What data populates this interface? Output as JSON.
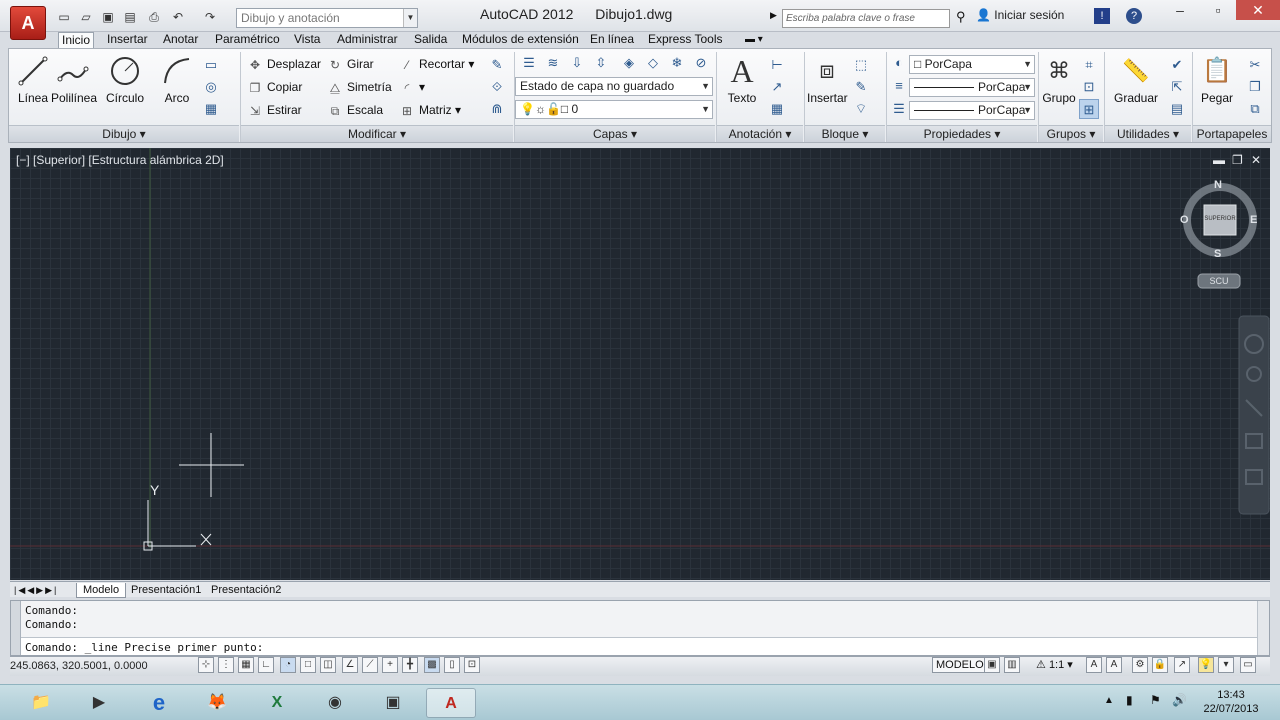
{
  "titlebar": {
    "app_button": "A",
    "workspace": "Dibujo y anotación",
    "app_name": "AutoCAD 2012",
    "doc_name": "Dibujo1.dwg",
    "search_placeholder": "Escriba palabra clave o frase",
    "signin": "Iniciar sesión"
  },
  "tabs": [
    "Inicio",
    "Insertar",
    "Anotar",
    "Paramétrico",
    "Vista",
    "Administrar",
    "Salida",
    "Módulos de extensión",
    "En línea",
    "Express Tools"
  ],
  "ribbon": {
    "draw": {
      "title": "Dibujo",
      "linea": "Línea",
      "polilinea": "Polilínea",
      "circulo": "Círculo",
      "arco": "Arco"
    },
    "modify": {
      "title": "Modificar",
      "desplazar": "Desplazar",
      "girar": "Girar",
      "recortar": "Recortar",
      "copiar": "Copiar",
      "simetria": "Simetría",
      "estirar": "Estirar",
      "escala": "Escala",
      "matriz": "Matriz"
    },
    "layers": {
      "title": "Capas",
      "state": "Estado de capa no guardado",
      "current": "0"
    },
    "annotation": {
      "title": "Anotación",
      "texto": "Texto"
    },
    "block": {
      "title": "Bloque",
      "insertar": "Insertar"
    },
    "properties": {
      "title": "Propiedades",
      "color": "PorCapa",
      "linetype": "PorCapa",
      "lineweight": "PorCapa"
    },
    "groups": {
      "title": "Grupos",
      "grupo": "Grupo"
    },
    "utilities": {
      "title": "Utilidades",
      "graduar": "Graduar"
    },
    "clipboard": {
      "title": "Portapapeles",
      "pegar": "Pegar"
    }
  },
  "viewport": {
    "label": "[−] [Superior] [Estructura alámbrica 2D]",
    "viewcube": {
      "n": "N",
      "s": "S",
      "e": "E",
      "w": "O",
      "face": "SUPERIOR",
      "ucs": "SCU"
    },
    "ucs_x": "X",
    "ucs_y": "Y"
  },
  "layout_tabs": [
    "Modelo",
    "Presentación1",
    "Presentación2"
  ],
  "command": {
    "line1": "Comando:",
    "line2": "Comando:",
    "prompt": "Comando:  _line Precise primer punto:"
  },
  "status": {
    "coords": "245.0863, 320.5001, 0.0000",
    "model": "MODELO",
    "scale": "1:1"
  },
  "taskbar": {
    "time": "13:43",
    "date": "22/07/2013"
  },
  "colors": {
    "canvas": "#212830",
    "accent": "#c0281f"
  }
}
